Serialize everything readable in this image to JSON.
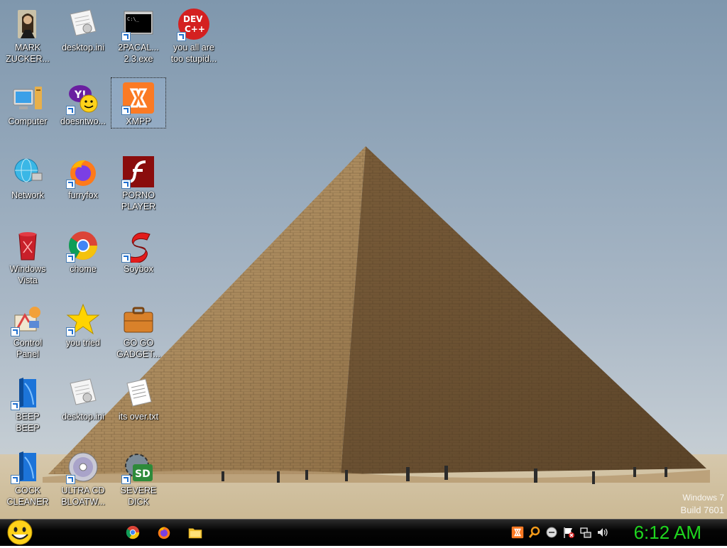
{
  "desktop": {
    "icons": [
      {
        "label": "MARK\nZUCKER...",
        "icon": "mark-zuckerberg-icon"
      },
      {
        "label": "desktop.ini",
        "icon": "ini-file-icon"
      },
      {
        "label": "2PACAL...\n2.3.exe",
        "icon": "terminal-exe-icon"
      },
      {
        "label": "you all are\ntoo stupid...",
        "icon": "dev-cpp-icon"
      },
      {
        "label": "Computer",
        "icon": "computer-icon"
      },
      {
        "label": "doesntwo...",
        "icon": "yahoo-messenger-icon"
      },
      {
        "label": "XMPP",
        "icon": "xampp-icon"
      },
      {
        "label": "Network",
        "icon": "network-icon"
      },
      {
        "label": "furryfox",
        "icon": "firefox-icon"
      },
      {
        "label": "PORNO\nPLAYER",
        "icon": "flash-player-icon"
      },
      {
        "label": "Windows\nVista",
        "icon": "recycle-bin-icon"
      },
      {
        "label": "chome",
        "icon": "chrome-icon"
      },
      {
        "label": "Soybox",
        "icon": "soybox-icon"
      },
      {
        "label": "Control\nPanel",
        "icon": "control-panel-icon"
      },
      {
        "label": "you tried",
        "icon": "star-icon"
      },
      {
        "label": "GO GO\nGADGET...",
        "icon": "briefcase-icon"
      },
      {
        "label": "BEEP\nBEEP",
        "icon": "blue-book-icon"
      },
      {
        "label": "desktop.ini",
        "icon": "ini-file-icon"
      },
      {
        "label": "its over.txt",
        "icon": "text-file-icon"
      },
      {
        "label": "COCK\nCLEANER",
        "icon": "blue-book-icon"
      },
      {
        "label": "ULTRA CD\nBLOATW...",
        "icon": "cd-icon"
      },
      {
        "label": "SEVERE\nDICK",
        "icon": "sd-gear-icon"
      }
    ],
    "watermark": {
      "line1": "Windows 7",
      "line2": "Build 7601"
    }
  },
  "taskbar": {
    "start_icon": "smiley-start-icon",
    "pinned": [
      "chrome-icon",
      "firefox-icon",
      "folder-icon"
    ],
    "tray": [
      "xampp-icon",
      "search-icon",
      "messenger-icon",
      "action-center-flag-icon",
      "network-icon",
      "volume-icon"
    ],
    "clock": "6:12 AM"
  },
  "colors": {
    "clock": "#1fd51f",
    "taskbar": "#000000"
  }
}
